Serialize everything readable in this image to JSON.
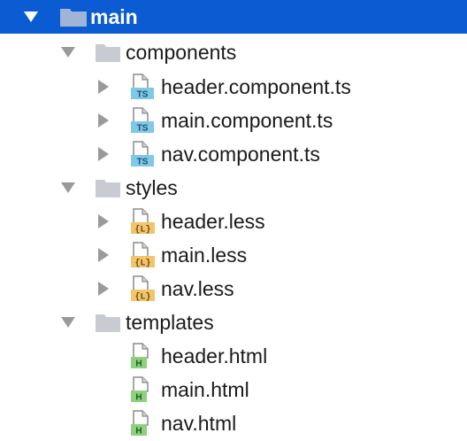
{
  "tree": {
    "root": {
      "label": "main",
      "expanded": true,
      "selected": true
    },
    "folders": [
      {
        "label": "components",
        "expanded": true,
        "files": [
          {
            "label": "header.component.ts",
            "badge": "TS",
            "type": "typescript",
            "expandable": true
          },
          {
            "label": "main.component.ts",
            "badge": "TS",
            "type": "typescript",
            "expandable": true
          },
          {
            "label": "nav.component.ts",
            "badge": "TS",
            "type": "typescript",
            "expandable": true
          }
        ]
      },
      {
        "label": "styles",
        "expanded": true,
        "files": [
          {
            "label": "header.less",
            "badge": "{L}",
            "type": "less",
            "expandable": true
          },
          {
            "label": "main.less",
            "badge": "{L}",
            "type": "less",
            "expandable": true
          },
          {
            "label": "nav.less",
            "badge": "{L}",
            "type": "less",
            "expandable": true
          }
        ]
      },
      {
        "label": "templates",
        "expanded": true,
        "files": [
          {
            "label": "header.html",
            "badge": "H",
            "type": "html",
            "expandable": false
          },
          {
            "label": "main.html",
            "badge": "H",
            "type": "html",
            "expandable": false
          },
          {
            "label": "nav.html",
            "badge": "H",
            "type": "html",
            "expandable": false
          }
        ]
      }
    ]
  },
  "colors": {
    "selection": "#0b5bd3",
    "folder": "#c8ccd2",
    "typescript_badge": "#7ec8e8",
    "less_badge": "#f2c56b",
    "html_badge": "#8fd07f"
  }
}
